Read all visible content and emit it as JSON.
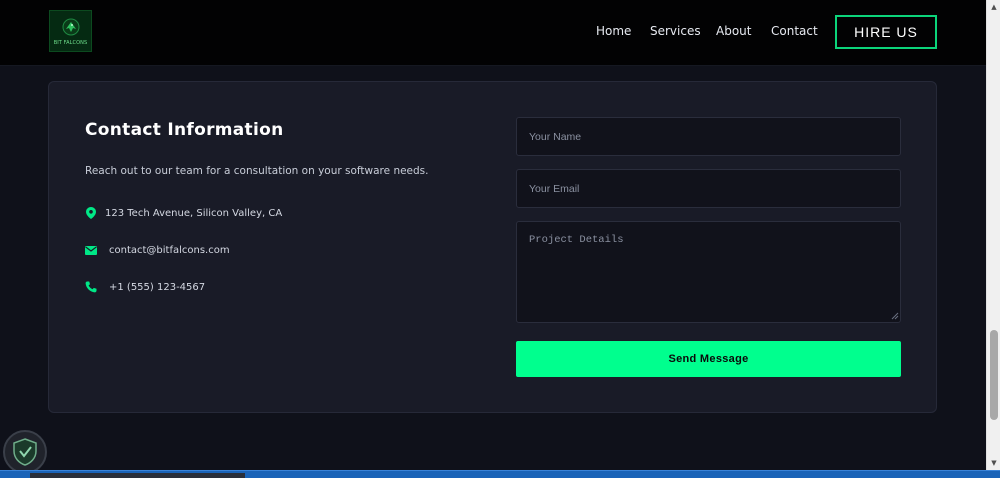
{
  "header": {
    "logo_text": "BIT FALCONS",
    "nav": [
      {
        "label": "Home"
      },
      {
        "label": "Services"
      },
      {
        "label": "About"
      },
      {
        "label": "Contact"
      }
    ],
    "cta_label": "HIRE US",
    "accent_color": "#0bd47b"
  },
  "contact": {
    "title": "Contact Information",
    "description": "Reach out to our team for a consultation on your software needs.",
    "address": "123 Tech Avenue, Silicon Valley, CA",
    "email": "contact@bitfalcons.com",
    "phone": "+1 (555) 123-4567",
    "icon_color": "#00e887"
  },
  "form": {
    "name_placeholder": "Your Name",
    "email_placeholder": "Your Email",
    "details_placeholder": "Project Details",
    "submit_label": "Send Message",
    "button_color": "#00ff8e"
  },
  "icons": {
    "address": "map-pin-icon",
    "email": "envelope-icon",
    "phone": "phone-icon",
    "widget": "shield-icon"
  }
}
